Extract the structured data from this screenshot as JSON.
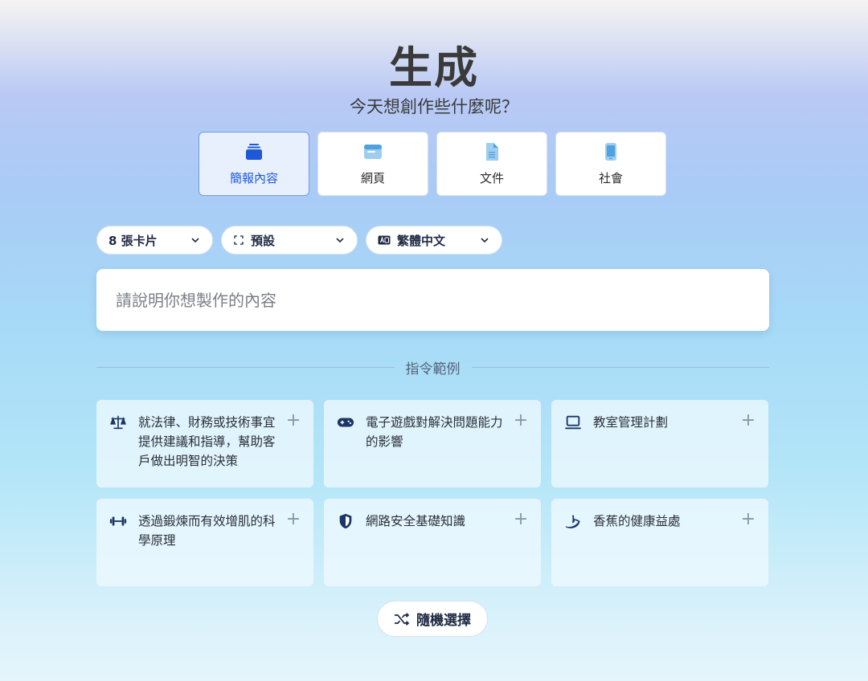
{
  "header": {
    "title": "生成",
    "subtitle": "今天想創作些什麼呢？"
  },
  "content_types": [
    {
      "label": "簡報內容",
      "icon": "presentation-stack-icon",
      "selected": true
    },
    {
      "label": "網頁",
      "icon": "webpage-icon",
      "selected": false
    },
    {
      "label": "文件",
      "icon": "document-icon",
      "selected": false
    },
    {
      "label": "社會",
      "icon": "mobile-phone-icon",
      "selected": false
    }
  ],
  "options": {
    "cards": {
      "value": "8 張卡片"
    },
    "format": {
      "value": "預設",
      "icon": "aspect-ratio-icon"
    },
    "language": {
      "value": "繁體中文",
      "icon": "language-icon"
    }
  },
  "prompt": {
    "placeholder": "請說明你想製作的內容",
    "value": ""
  },
  "examples_section": {
    "label": "指令範例",
    "items": [
      {
        "text": "就法律、財務或技術事宜提供建議和指導，幫助客戶做出明智的決策",
        "icon": "scales-icon"
      },
      {
        "text": "電子遊戲對解決問題能力的影響",
        "icon": "gamepad-icon"
      },
      {
        "text": "教室管理計劃",
        "icon": "laptop-icon"
      },
      {
        "text": "透過鍛煉而有效增肌的科學原理",
        "icon": "dumbbell-icon"
      },
      {
        "text": "網路安全基礎知識",
        "icon": "shield-icon"
      },
      {
        "text": "香蕉的健康益處",
        "icon": "banana-icon"
      }
    ]
  },
  "random_button": {
    "label": "隨機選擇",
    "icon": "shuffle-icon"
  },
  "colors": {
    "accent": "#1f58d6",
    "icon_dark": "#1a3566",
    "text_dark": "#1f2a44"
  }
}
